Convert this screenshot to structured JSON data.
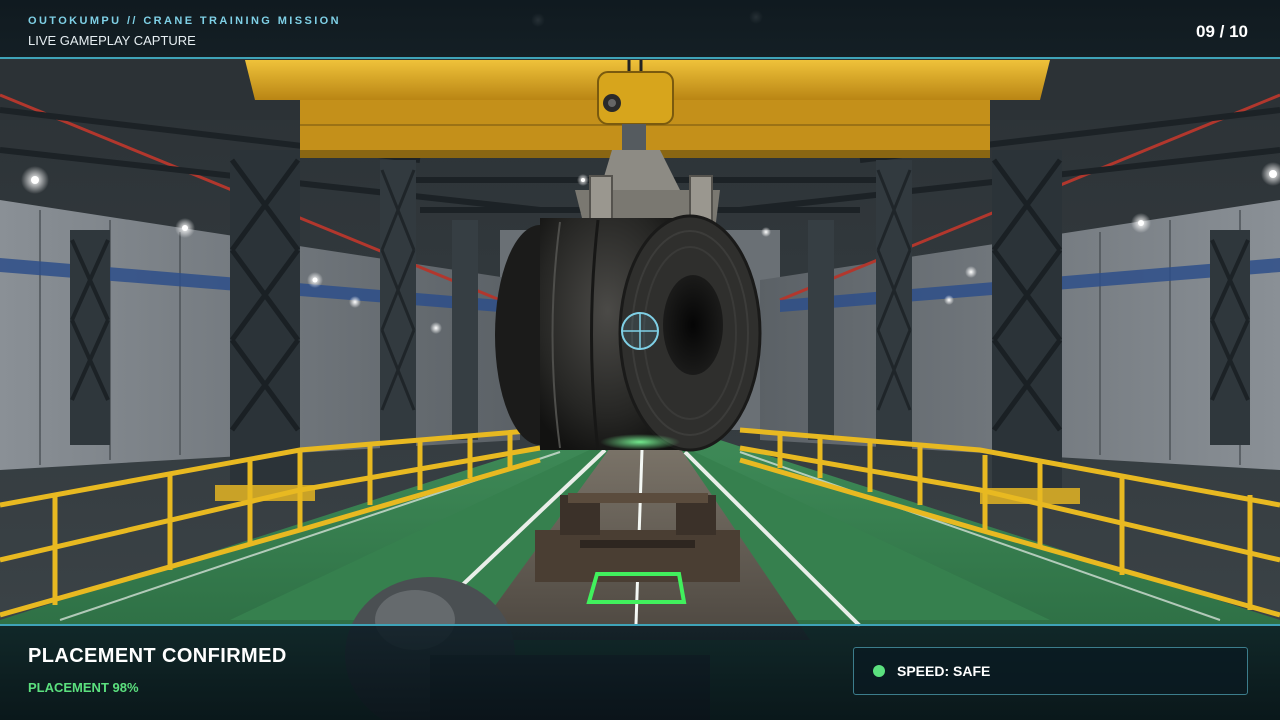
{
  "hud": {
    "mission_title": "OUTOKUMPU // CRANE TRAINING MISSION",
    "capture_label": "LIVE GAMEPLAY CAPTURE",
    "progress_counter": "09 / 10",
    "status_title": "PLACEMENT CONFIRMED",
    "placement_readout": "PLACEMENT 98%",
    "placement_accuracy": 0.98,
    "speed_status": "SPEED: SAFE"
  },
  "colors": {
    "accent_cyan": "#3fa3b8",
    "title_cyan": "#7fd0e6",
    "confirm_green": "#5be07e",
    "floor_green": "#2f7a4a",
    "crane_yellow": "#d9a51c",
    "railing_yellow": "#e8b921"
  },
  "icons": {
    "crosshair": "crosshair-icon",
    "speed_indicator": "status-dot-icon"
  }
}
